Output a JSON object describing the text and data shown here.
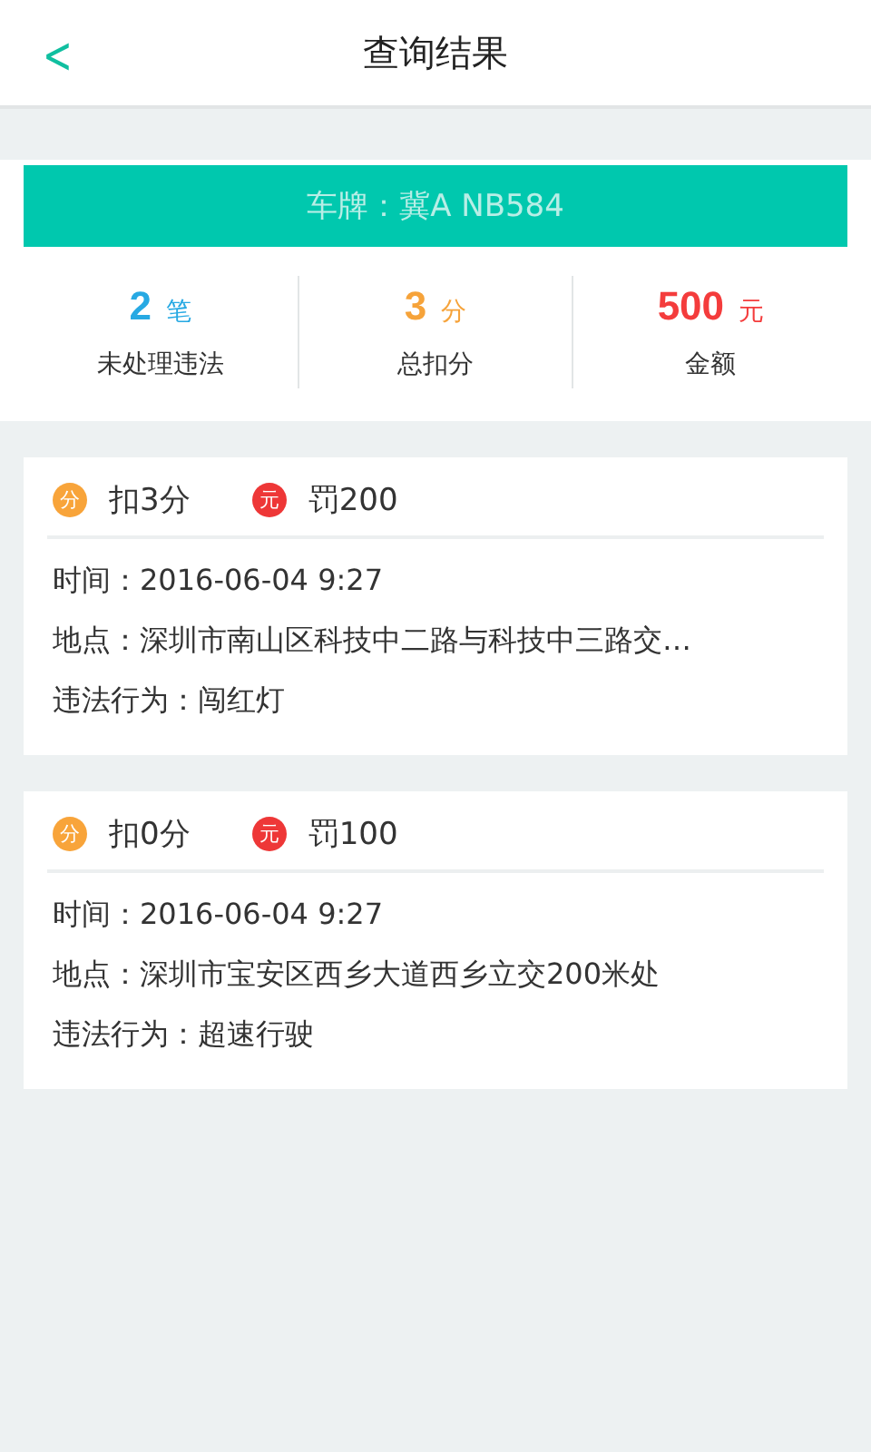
{
  "header": {
    "back": "<",
    "title": "查询结果"
  },
  "plate": "车牌：冀A NB584",
  "stats": [
    {
      "kind": "count",
      "value": "2",
      "unit": "笔",
      "label": "未处理违法"
    },
    {
      "kind": "points",
      "value": "3",
      "unit": "分",
      "label": "总扣分"
    },
    {
      "kind": "fine",
      "value": "500",
      "unit": "元",
      "label": "金额"
    }
  ],
  "records": [
    {
      "points_icon": "分",
      "points": "扣3分",
      "fine_icon": "元",
      "fine": "罚200",
      "time": "时间：2016-06-04  9:27",
      "place": "地点：深圳市南山区科技中二路与科技中三路交…",
      "act": "违法行为：闯红灯"
    },
    {
      "points_icon": "分",
      "points": "扣0分",
      "fine_icon": "元",
      "fine": "罚100",
      "time": "时间：2016-06-04  9:27",
      "place": "地点：深圳市宝安区西乡大道西乡立交200米处",
      "act": "违法行为：超速行驶"
    }
  ]
}
